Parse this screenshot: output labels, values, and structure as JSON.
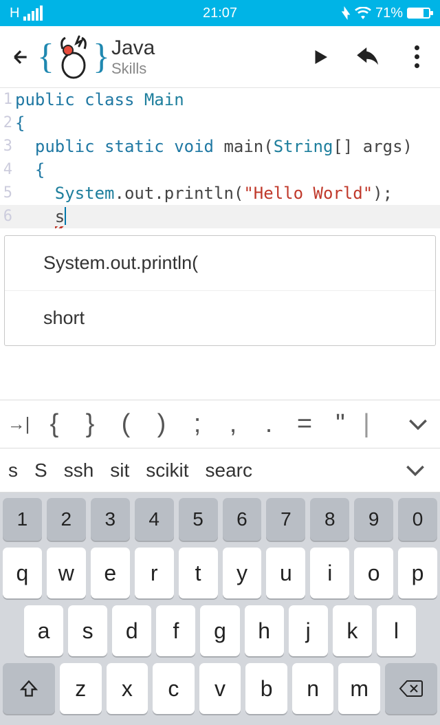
{
  "status": {
    "network": "H",
    "time": "21:07",
    "battery": "71%"
  },
  "appBar": {
    "title": "Java",
    "subtitle": "Skills"
  },
  "code": {
    "lines": [
      {
        "n": "1",
        "html": "<span class='kw'>public class</span> <span class='cls'>Main</span>"
      },
      {
        "n": "2",
        "html": "<span class='kw'>{</span>"
      },
      {
        "n": "3",
        "html": "  <span class='kw'>public static</span> <span class='type'>void</span> <span class='pln'>main(</span><span class='cls'>String</span><span class='pln'>[] args)</span>"
      },
      {
        "n": "4",
        "html": "  <span class='kw'>{</span>"
      },
      {
        "n": "5",
        "html": "    <span class='cls'>System</span><span class='pln'>.out.println(</span><span class='str'>\"Hello World\"</span><span class='pln'>);</span>"
      },
      {
        "n": "6",
        "html": "    <span class='squig pln'>s</span><span class='cursor'></span>"
      }
    ]
  },
  "suggestions": [
    "System.out.println(",
    "short"
  ],
  "symbolRow": [
    "→|",
    "{",
    "}",
    "(",
    ")",
    ";",
    ",",
    ".",
    "=",
    "\"",
    "|",
    "∨"
  ],
  "predictions": [
    "s",
    "S",
    "ssh",
    "sit",
    "scikit",
    "searc"
  ],
  "keyboard": {
    "row1": [
      "1",
      "2",
      "3",
      "4",
      "5",
      "6",
      "7",
      "8",
      "9",
      "0"
    ],
    "row2": [
      "q",
      "w",
      "e",
      "r",
      "t",
      "y",
      "u",
      "i",
      "o",
      "p"
    ],
    "row3": [
      "a",
      "s",
      "d",
      "f",
      "g",
      "h",
      "j",
      "k",
      "l"
    ],
    "row4": [
      "z",
      "x",
      "c",
      "v",
      "b",
      "n",
      "m"
    ]
  }
}
